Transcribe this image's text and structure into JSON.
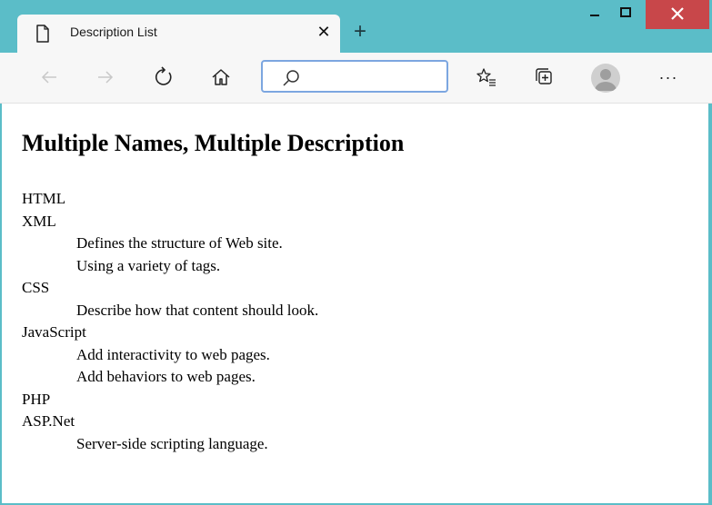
{
  "window": {
    "tab_title": "Description List"
  },
  "toolbar": {
    "address_value": "",
    "icons": {
      "back": "back-arrow-icon",
      "forward": "forward-arrow-icon",
      "refresh": "refresh-icon",
      "home": "home-icon",
      "search": "search-icon",
      "favorites": "favorites-icon",
      "collections": "collections-icon",
      "profile": "profile-icon",
      "more": "more-icon"
    },
    "more_label": "···"
  },
  "page": {
    "heading": "Multiple Names, Multiple Description",
    "items": [
      {
        "type": "dt",
        "text": "HTML"
      },
      {
        "type": "dt",
        "text": "XML"
      },
      {
        "type": "dd",
        "text": "Defines the structure of Web site."
      },
      {
        "type": "dd",
        "text": "Using a variety of tags."
      },
      {
        "type": "dt",
        "text": "CSS"
      },
      {
        "type": "dd",
        "text": "Describe how that content should look."
      },
      {
        "type": "dt",
        "text": "JavaScript"
      },
      {
        "type": "dd",
        "text": "Add interactivity to web pages."
      },
      {
        "type": "dd",
        "text": "Add behaviors to web pages."
      },
      {
        "type": "dt",
        "text": "PHP"
      },
      {
        "type": "dt",
        "text": "ASP.Net"
      },
      {
        "type": "dd",
        "text": "Server-side scripting language."
      }
    ]
  },
  "colors": {
    "frame": "#5bbdc8",
    "close_button": "#c8474a",
    "address_focus": "#7ca6e0"
  }
}
